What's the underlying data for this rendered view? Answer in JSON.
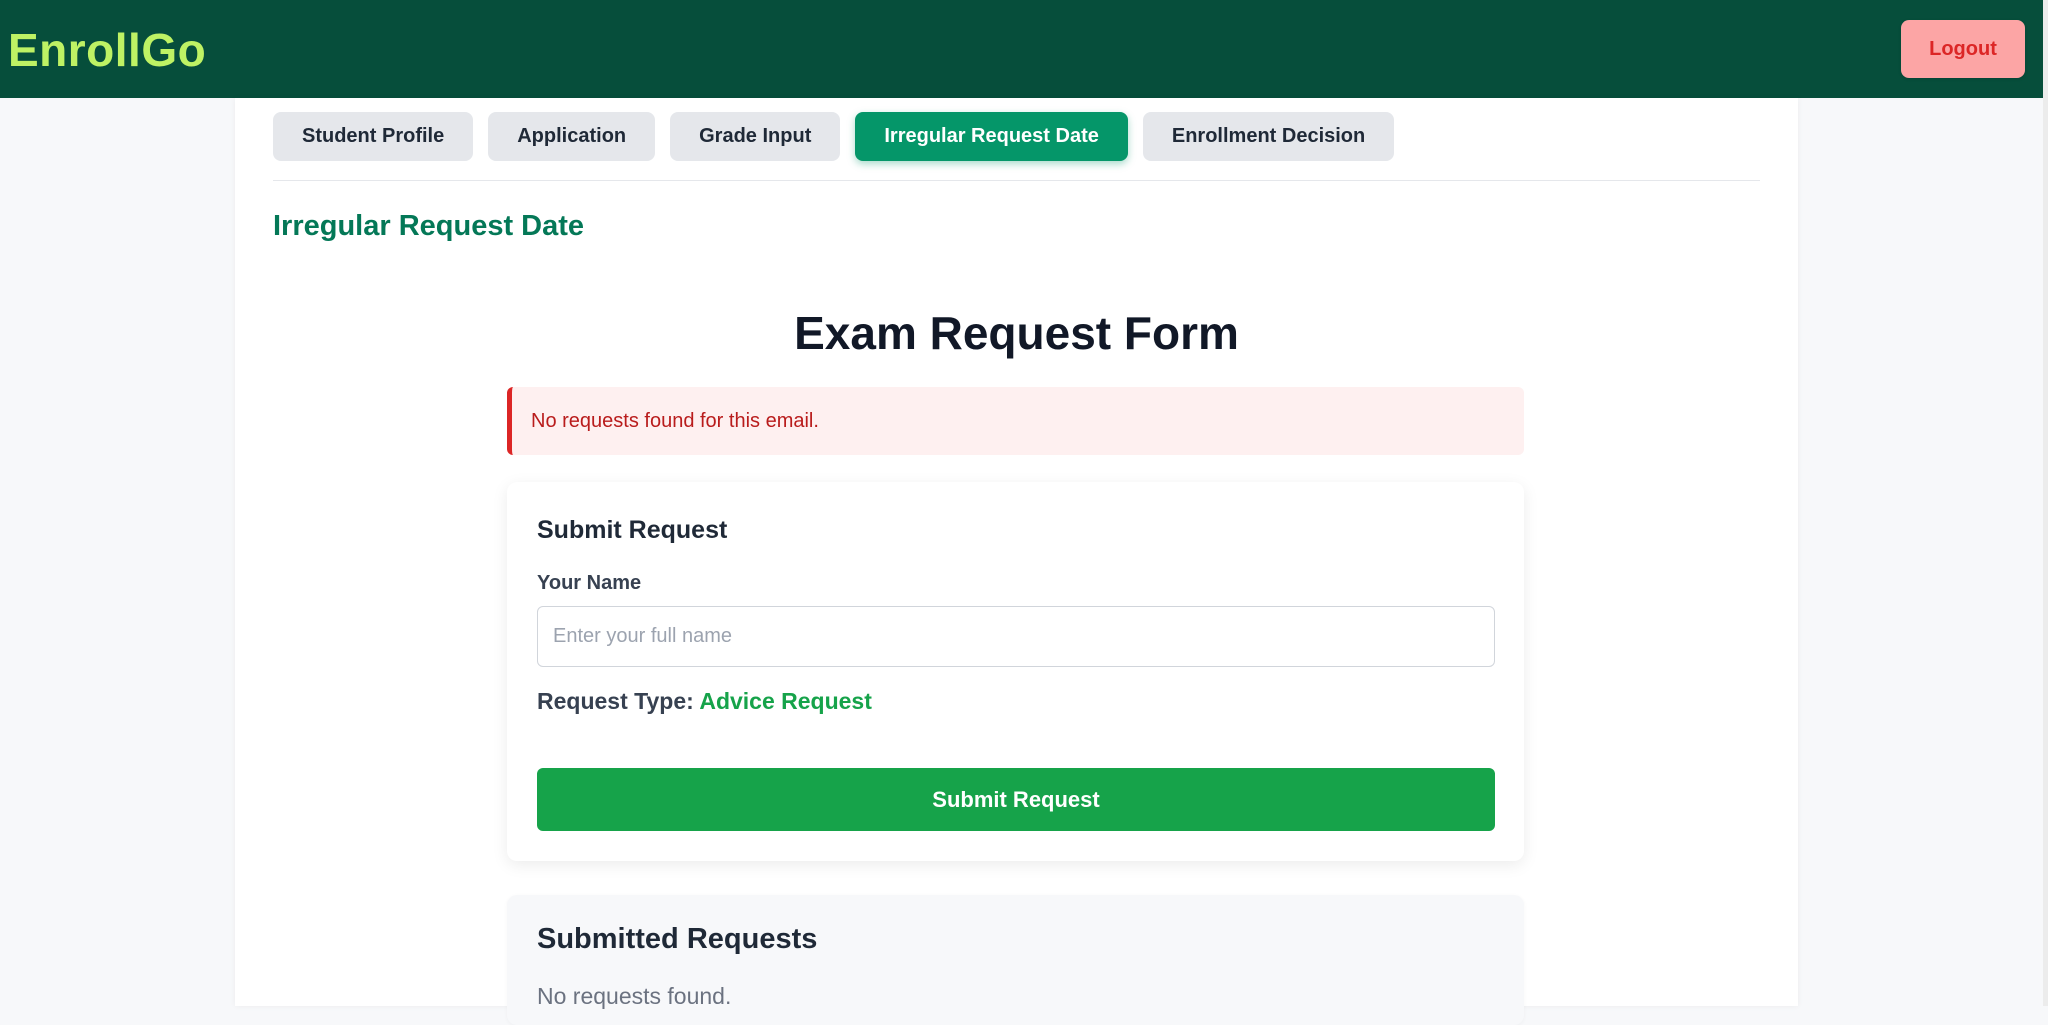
{
  "app": {
    "brand": "EnrollGo",
    "logout_label": "Logout"
  },
  "tabs": [
    {
      "label": "Student Profile",
      "active": false
    },
    {
      "label": "Application",
      "active": false
    },
    {
      "label": "Grade Input",
      "active": false
    },
    {
      "label": "Irregular Request Date",
      "active": true
    },
    {
      "label": "Enrollment Decision",
      "active": false
    }
  ],
  "page": {
    "section_title": "Irregular Request Date",
    "form_title": "Exam Request Form",
    "alert_message": "No requests found for this email."
  },
  "submit_card": {
    "title": "Submit Request",
    "name_label": "Your Name",
    "name_placeholder": "Enter your full name",
    "name_value": "",
    "request_type_label": "Request Type:",
    "request_type_value": "Advice Request",
    "submit_label": "Submit Request"
  },
  "submitted": {
    "title": "Submitted Requests",
    "empty_message": "No requests found."
  },
  "colors": {
    "header_bg": "#064e3b",
    "brand": "#bef264",
    "accent": "#059669",
    "submit": "#16a34a",
    "alert": "#dc2626",
    "logout_bg": "#fca5a5"
  }
}
